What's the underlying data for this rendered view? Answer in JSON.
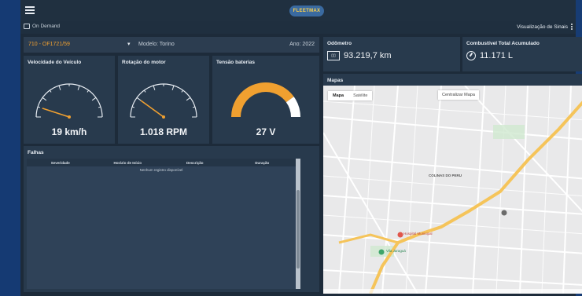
{
  "app": {
    "logo_text": "FLEETMAX"
  },
  "subbar": {
    "on_demand_label": "On Demand",
    "visualizacao_label": "Visualização de Sinais"
  },
  "vehicle": {
    "plate": "710 - OF1721/59",
    "model": "Modelo: Torino",
    "year": "Ano: 2022"
  },
  "gauges": [
    {
      "title": "Velocidade do Veículo",
      "value": "19 km/h",
      "level": 0.1,
      "color": "#f0a030"
    },
    {
      "title": "Rotação do motor",
      "value": "1.018 RPM",
      "level": 0.2,
      "color": "#f0a030"
    },
    {
      "title": "Tensão baterias",
      "value": "27 V",
      "level": 0.8,
      "color": "#f0a030"
    }
  ],
  "falhas": {
    "title": "Falhas",
    "columns": [
      "Severidade",
      "Horário de Início",
      "Descrição",
      "Duração"
    ],
    "empty_text": "Nenhum registro disponível"
  },
  "odometro": {
    "title": "Odômetro",
    "value": "93.219,7 km"
  },
  "combustivel": {
    "title": "Combustível Total Acumulado",
    "value": "11.171 L"
  },
  "mapas": {
    "title": "Mapas",
    "tab_map": "Mapa",
    "tab_satellite": "Satélite",
    "center_button": "Centralizar Mapa",
    "labels": [
      "COLINAS DO PERU",
      "Hospital Municipal",
      "Vila Jaraguá"
    ]
  },
  "icons": {
    "menu": "hamburger-icon",
    "on_demand": "monitor-icon",
    "more": "kebab-icon",
    "odometer": "odometer-icon",
    "fuel": "gauge-icon"
  }
}
